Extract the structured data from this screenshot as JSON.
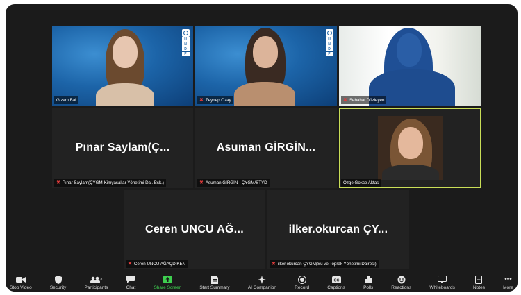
{
  "participants": {
    "p1": {
      "name": "Gizem Bal",
      "muted": false,
      "has_undp_logo": true
    },
    "p2": {
      "name": "Zeynep Ozay",
      "muted": true,
      "has_undp_logo": true
    },
    "p3": {
      "name": "Sebahat Düzleyen",
      "muted": true
    },
    "p4": {
      "display": "Pınar  Saylam(Ç...",
      "caption": "Pınar Saylam(ÇYGM-Kimyasallar Yönetimi Dai. Bşk.)",
      "muted": true
    },
    "p5": {
      "display": "Asuman  GİRGİN...",
      "caption": "Asuman GİRGİN - ÇYGM/STYD",
      "muted": true
    },
    "p6": {
      "name": "Ozge Gokce Aktas",
      "active_speaker": true,
      "muted": false
    },
    "p7": {
      "display": "Ceren  UNCU  AĞ...",
      "caption": "Ceren UNCU AĞAÇDİKEN",
      "muted": true
    },
    "p8": {
      "display": "ilker.okurcan  ÇY...",
      "caption": "ilker.okurcan ÇYGM(Su ve Toprak Yönetimi Dairesi)",
      "muted": true
    }
  },
  "undp_logo": {
    "letters": [
      "U",
      "N",
      "D",
      "P"
    ]
  },
  "toolbar": {
    "stop_video": {
      "label": "Stop Video",
      "icon": "video-camera-icon"
    },
    "security": {
      "label": "Security",
      "icon": "shield-icon"
    },
    "participants": {
      "label": "Participants",
      "count": "8",
      "icon": "people-icon"
    },
    "chat": {
      "label": "Chat",
      "icon": "chat-bubble-icon"
    },
    "share_screen": {
      "label": "Share Screen",
      "icon": "share-arrow-icon",
      "color": "#3ecf4f"
    },
    "start_summary": {
      "label": "Start Summary",
      "icon": "document-icon"
    },
    "ai_companion": {
      "label": "AI Companion",
      "icon": "sparkle-icon"
    },
    "record": {
      "label": "Record",
      "icon": "record-icon"
    },
    "captions": {
      "label": "Captions",
      "icon": "cc-icon"
    },
    "polls": {
      "label": "Polls",
      "icon": "bar-chart-icon"
    },
    "reactions": {
      "label": "Reactions",
      "icon": "smiley-icon"
    },
    "whiteboards": {
      "label": "Whiteboards",
      "icon": "whiteboard-icon"
    },
    "notes": {
      "label": "Notes",
      "icon": "notes-icon"
    },
    "more": {
      "label": "More",
      "icon": "ellipsis-icon"
    }
  },
  "colors": {
    "active_speaker_border": "#c9de57",
    "muted_mic": "#e23b3b",
    "tile_bg": "#222222"
  }
}
